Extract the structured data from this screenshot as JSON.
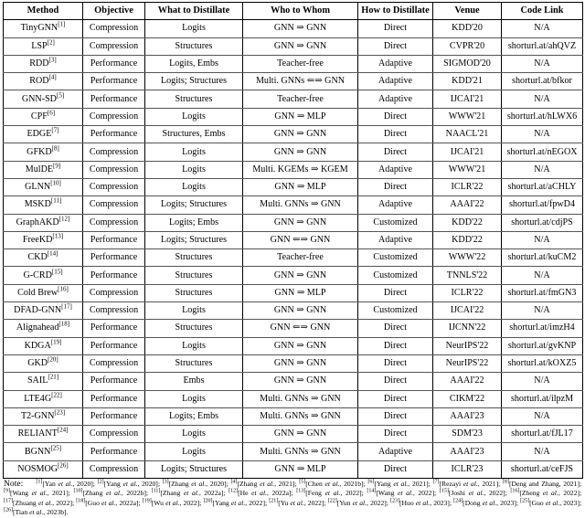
{
  "table": {
    "columns": [
      "Method",
      "Objective",
      "What to Distillate",
      "Who to Whom",
      "How to Distillate",
      "Venue",
      "Code Link"
    ],
    "rows": [
      {
        "method": "TinyGNN",
        "ref": "[1]",
        "objective": "Compression",
        "what": "Logits",
        "who": "GNN ⇒ GNN",
        "how": "Direct",
        "venue": "KDD'20",
        "code": "N/A"
      },
      {
        "method": "LSP",
        "ref": "[2]",
        "objective": "Compression",
        "what": "Structures",
        "who": "GNN ⇒ GNN",
        "how": "Direct",
        "venue": "CVPR'20",
        "code": "shorturl.at/ahQVZ"
      },
      {
        "method": "RDD",
        "ref": "[3]",
        "objective": "Performance",
        "what": "Logits, Embs",
        "who": "Teacher-free",
        "how": "Adaptive",
        "venue": "SIGMOD'20",
        "code": "N/A"
      },
      {
        "method": "ROD",
        "ref": "[4]",
        "objective": "Performance",
        "what": "Logits; Structures",
        "who": "Multi. GNNs ⇐⇒ GNN",
        "how": "Adaptive",
        "venue": "KDD'21",
        "code": "shorturl.at/bfkor"
      },
      {
        "method": "GNN-SD",
        "ref": "[5]",
        "objective": "Performance",
        "what": "Structures",
        "who": "Teacher-free",
        "how": "Adaptive",
        "venue": "IJCAI'21",
        "code": "N/A"
      },
      {
        "method": "CPF",
        "ref": "[6]",
        "objective": "Compression",
        "what": "Logits",
        "who": "GNN ⇒ MLP",
        "how": "Direct",
        "venue": "WWW'21",
        "code": "shorturl.at/hLWX6"
      },
      {
        "method": "EDGE",
        "ref": "[7]",
        "objective": "Performance",
        "what": "Structures, Embs",
        "who": "GNN ⇒ GNN",
        "how": "Direct",
        "venue": "NAACL'21",
        "code": "N/A"
      },
      {
        "method": "GFKD",
        "ref": "[8]",
        "objective": "Compression",
        "what": "Logits",
        "who": "GNN ⇒ GNN",
        "how": "Direct",
        "venue": "IJCAI'21",
        "code": "shorturl.at/nEGOX"
      },
      {
        "method": "MulDE",
        "ref": "[9]",
        "objective": "Compression",
        "what": "Logits",
        "who": "Multi. KGEMs ⇒ KGEM",
        "how": "Adaptive",
        "venue": "WWW'21",
        "code": "N/A"
      },
      {
        "method": "GLNN",
        "ref": "[10]",
        "objective": "Compression",
        "what": "Logits",
        "who": "GNN ⇒ MLP",
        "how": "Direct",
        "venue": "ICLR'22",
        "code": "shorturl.at/aCHLY"
      },
      {
        "method": "MSKD",
        "ref": "[11]",
        "objective": "Compression",
        "what": "Logits; Structures",
        "who": "Multi. GNNs ⇒ GNN",
        "how": "Adaptive",
        "venue": "AAAI'22",
        "code": "shorturl.at/fpwD4"
      },
      {
        "method": "GraphAKD",
        "ref": "[12]",
        "objective": "Compression",
        "what": "Logits; Embs",
        "who": "GNN ⇒ GNN",
        "how": "Customized",
        "venue": "KDD'22",
        "code": "shorturl.at/cdjPS"
      },
      {
        "method": "FreeKD",
        "ref": "[13]",
        "objective": "Performance",
        "what": "Logits; Structures",
        "who": "GNN ⇐⇒ GNN",
        "how": "Adaptive",
        "venue": "KDD'22",
        "code": "N/A"
      },
      {
        "method": "CKD",
        "ref": "[14]",
        "objective": "Performance",
        "what": "Structures",
        "who": "Teacher-free",
        "how": "Customized",
        "venue": "WWW'22",
        "code": "shorturl.at/kuCM2"
      },
      {
        "method": "G-CRD",
        "ref": "[15]",
        "objective": "Performance",
        "what": "Structures",
        "who": "GNN ⇒ GNN",
        "how": "Customized",
        "venue": "TNNLS'22",
        "code": "N/A"
      },
      {
        "method": "Cold Brew",
        "ref": "[16]",
        "objective": "Compression",
        "what": "Structures",
        "who": "GNN ⇒ MLP",
        "how": "Direct",
        "venue": "ICLR'22",
        "code": "shorturl.at/fmGN3"
      },
      {
        "method": "DFAD-GNN",
        "ref": "[17]",
        "objective": "Compression",
        "what": "Logits",
        "who": "GNN ⇒ GNN",
        "how": "Customized",
        "venue": "IJCAI'22",
        "code": "N/A"
      },
      {
        "method": "Alignahead",
        "ref": "[18]",
        "objective": "Performance",
        "what": "Structures",
        "who": "GNN ⇐⇒ GNN",
        "how": "Direct",
        "venue": "IJCNN'22",
        "code": "shorturl.at/imzH4"
      },
      {
        "method": "KDGA",
        "ref": "[19]",
        "objective": "Performance",
        "what": "Logits",
        "who": "GNN ⇒ GNN",
        "how": "Direct",
        "venue": "NeurIPS'22",
        "code": "shorturl.at/gvKNP"
      },
      {
        "method": "GKD",
        "ref": "[20]",
        "objective": "Compression",
        "what": "Structures",
        "who": "GNN ⇒ GNN",
        "how": "Direct",
        "venue": "NeurIPS'22",
        "code": "shorturl.at/kOXZ5"
      },
      {
        "method": "SAIL",
        "ref": "[21]",
        "objective": "Performance",
        "what": "Embs",
        "who": "GNN ⇒ GNN",
        "how": "Direct",
        "venue": "AAAI'22",
        "code": "N/A"
      },
      {
        "method": "LTE4G",
        "ref": "[22]",
        "objective": "Performance",
        "what": "Logits",
        "who": "Multi. GNNs ⇒ GNN",
        "how": "Direct",
        "venue": "CIKM'22",
        "code": "shorturl.at/ilpzM"
      },
      {
        "method": "T2-GNN",
        "ref": "[23]",
        "objective": "Performance",
        "what": "Logits; Embs",
        "who": "Multi. GNNs ⇒ GNN",
        "how": "Direct",
        "venue": "AAAI'23",
        "code": "N/A"
      },
      {
        "method": "RELIANT",
        "ref": "[24]",
        "objective": "Compression",
        "what": "Logits",
        "who": "GNN ⇒ GNN",
        "how": "Direct",
        "venue": "SDM'23",
        "code": "shorturl.at/fJL17"
      },
      {
        "method": "BGNN",
        "ref": "[25]",
        "objective": "Performance",
        "what": "Logits",
        "who": "Multi. GNNs ⇒ GNN",
        "how": "Adaptive",
        "venue": "AAAI'23",
        "code": "N/A"
      },
      {
        "method": "NOSMOG",
        "ref": "[26]",
        "objective": "Compression",
        "what": "Logits; Structures",
        "who": "GNN ⇒ MLP",
        "how": "Direct",
        "venue": "ICLR'23",
        "code": "shorturl.at/ceFJS"
      }
    ]
  },
  "note": {
    "label": "Note:",
    "citations": [
      {
        "num": "[1]",
        "text": "[Yan et al., 2020]"
      },
      {
        "num": "[2]",
        "text": "[Yang et al., 2020]"
      },
      {
        "num": "[3]",
        "text": "[Zhang et al., 2020]"
      },
      {
        "num": "[4]",
        "text": "[Zhang et al., 2021]"
      },
      {
        "num": "[5]",
        "text": "[Chen et al., 2021b]"
      },
      {
        "num": "[6]",
        "text": "[Yang et al., 2021]"
      },
      {
        "num": "[7]",
        "text": "[Rezayi et al., 2021]"
      },
      {
        "num": "[8]",
        "text": "[Deng and Zhang, 2021]"
      },
      {
        "num": "[9]",
        "text": "[Wang et al., 2021]"
      },
      {
        "num": "[10]",
        "text": "[Zhang et al., 2022b]"
      },
      {
        "num": "[11]",
        "text": "[Zhang et al., 2022a]"
      },
      {
        "num": "[12]",
        "text": "[He et al., 2022a]"
      },
      {
        "num": "[13]",
        "text": "[Feng et al., 2022]"
      },
      {
        "num": "[14]",
        "text": "[Wang et al., 2022]"
      },
      {
        "num": "[15]",
        "text": "[Joshi et al., 2022]"
      },
      {
        "num": "[16]",
        "text": "[Zheng et al., 2022]"
      },
      {
        "num": "[17]",
        "text": "[Zhuang et al., 2022]"
      },
      {
        "num": "[18]",
        "text": "[Guo et al., 2022a]"
      },
      {
        "num": "[19]",
        "text": "[Wu et al., 2022]"
      },
      {
        "num": "[20]",
        "text": "[Yang et al., 2022]"
      },
      {
        "num": "[21]",
        "text": "[Yu et al., 2022]"
      },
      {
        "num": "[22]",
        "text": "[Yun et al., 2022]"
      },
      {
        "num": "[23]",
        "text": "[Huo et al., 2023]"
      },
      {
        "num": "[24]",
        "text": "[Dong et al., 2023]"
      },
      {
        "num": "[25]",
        "text": "[Guo et al., 2023]"
      },
      {
        "num": "[26]",
        "text": "[Tian et al., 2023b]"
      }
    ]
  }
}
